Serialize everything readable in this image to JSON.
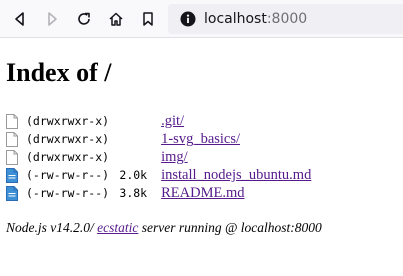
{
  "browser": {
    "url_host": "localhost",
    "url_port": ":8000",
    "icons": [
      "back-icon",
      "forward-icon",
      "reload-icon",
      "home-icon",
      "bookmark-icon",
      "info-icon"
    ]
  },
  "page": {
    "title": "Index of /",
    "entries": [
      {
        "mode": "(drwxrwxr-x)",
        "size": "",
        "name": ".git/",
        "type": "dir"
      },
      {
        "mode": "(drwxrwxr-x)",
        "size": "",
        "name": "1-svg_basics/",
        "type": "dir"
      },
      {
        "mode": "(drwxrwxr-x)",
        "size": "",
        "name": "img/",
        "type": "dir"
      },
      {
        "mode": "(-rw-rw-r--)",
        "size": "2.0k",
        "name": "install_nodejs_ubuntu.md",
        "type": "file"
      },
      {
        "mode": "(-rw-rw-r--)",
        "size": "3.8k",
        "name": "README.md",
        "type": "file"
      }
    ],
    "footer": {
      "prefix": "Node.js v14.2.0/ ",
      "link": "ecstatic",
      "suffix": " server running @ localhost:8000"
    }
  },
  "colors": {
    "link": "#551a8b",
    "toolbar": "#f9f9fb",
    "urlbar": "#f0f0f4",
    "file_icon": "#3d8fd6"
  }
}
